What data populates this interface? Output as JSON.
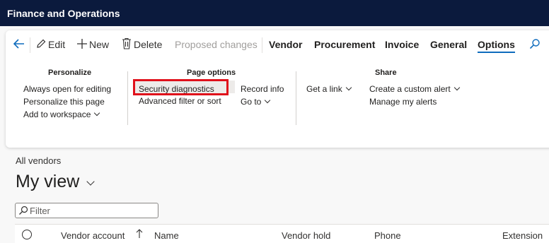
{
  "app": {
    "title": "Finance and Operations"
  },
  "actionbar": {
    "edit": "Edit",
    "new": "New",
    "delete": "Delete",
    "proposed_changes": "Proposed changes",
    "tabs": [
      "Vendor",
      "Procurement",
      "Invoice",
      "General",
      "Options"
    ],
    "selected_tab": "Options"
  },
  "groups": {
    "personalize": {
      "title": "Personalize",
      "items": [
        "Always open for editing",
        "Personalize this page",
        "Add to workspace"
      ]
    },
    "page_options": {
      "title": "Page options",
      "items": [
        "Security diagnostics",
        "Advanced filter or sort",
        "Record info",
        "Go to"
      ]
    },
    "share": {
      "title": "Share",
      "items": [
        "Get a link",
        "Create a custom alert",
        "Manage my alerts"
      ]
    }
  },
  "page": {
    "breadcrumb": "All vendors",
    "view_title": "My view",
    "filter_placeholder": "Filter"
  },
  "grid": {
    "columns": [
      "Vendor account",
      "Name",
      "Vendor hold",
      "Phone",
      "Extension"
    ]
  },
  "colors": {
    "topbar": "#0b1a3d",
    "accent": "#0f6cbd",
    "highlight": "#e0111b"
  }
}
